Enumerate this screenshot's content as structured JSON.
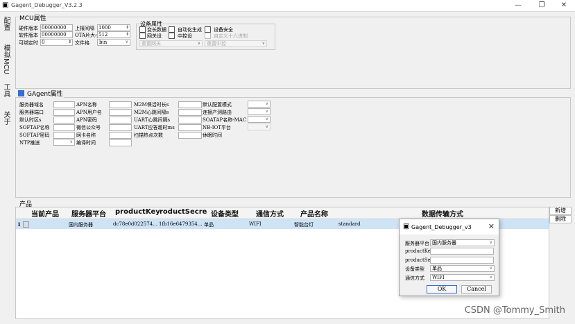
{
  "window": {
    "title": "Gagent_Debugger_V3.2.3"
  },
  "side_tabs": [
    "配置",
    "模拟MCU",
    "工具",
    "关于"
  ],
  "mcu": {
    "title": "MCU属性",
    "hw_label": "硬件版本",
    "hw_value": "00000000",
    "sw_label": "软件版本",
    "sw_value": "00000000",
    "bind_label": "可绑定时",
    "bind_value": "0",
    "report_label": "上报间隔",
    "report_value": "1000",
    "ota_label": "OTA片大小",
    "ota_value": "512",
    "fmt_label": "文件格",
    "fmt_value": "bin",
    "dev": {
      "title": "设备属性",
      "c1": "变长数据",
      "c2": "自动化生成",
      "c3": "设备安全",
      "c4": "网关设",
      "c5": "中控设",
      "c6": "自定义十六进制",
      "combo1": "重置网关",
      "combo2": "重置中控"
    }
  },
  "gagent": {
    "title": "GAgent属性",
    "col1": [
      "服务器域名",
      "服务器端口",
      "默认时区s",
      "SOFTAP名称",
      "SOFTAP密码",
      "NTP推送"
    ],
    "col2": [
      "APN名称",
      "APN用户名",
      "APN密码",
      "微信公众号",
      "网卡名称",
      "编译时间"
    ],
    "col3": [
      "M2M保活时长s",
      "M2M心跳间隔s",
      "UART心跳间隔s",
      "UART应答超时ms",
      "扫描热点次数"
    ],
    "col4": [
      "默认配置模式",
      "连接产测路由",
      "SOATAP名称-MAC",
      "NB-IOT平台",
      "休眠时间"
    ]
  },
  "product": {
    "title": "产品",
    "headers": [
      "当前产品",
      "服务器平台",
      "productKey",
      "roductSecre",
      "设备类型",
      "通信方式",
      "产品名称",
      "数据传输方式"
    ],
    "row": {
      "index": "1",
      "platform": "国内服务器",
      "key": "dc78e0d022574…",
      "secret": "1fb16e6479354…",
      "type": "单品",
      "comm": "WIFI",
      "name": "智能台灯",
      "transfer": "standard"
    },
    "add_label": "新增",
    "delete_label": "删除"
  },
  "dialog": {
    "title": "Gagent_Debugger_v3",
    "platform_label": "服务器平台",
    "platform_value": "国内服务器",
    "key_label": "productKe",
    "key_value": "",
    "secret_label": "productSe",
    "secret_value": "",
    "type_label": "设备类型",
    "type_value": "单品",
    "comm_label": "通信方式",
    "comm_value": "WIFI",
    "ok_label": "OK",
    "cancel_label": "Cancel"
  },
  "watermark": "CSDN @Tommy_Smith",
  "colors": {
    "accent": "#2f6fd6",
    "selected_row": "#cfe3f7"
  }
}
